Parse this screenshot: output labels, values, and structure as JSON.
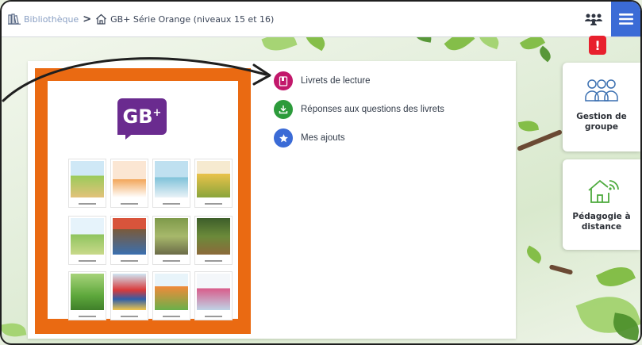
{
  "header": {
    "breadcrumb": {
      "library_label": "Bibliothèque",
      "separator": ">",
      "current_label": "GB+ Série Orange (niveaux 15 et 16)"
    },
    "icons": {
      "library": "books-icon",
      "home": "home-icon",
      "group": "group-icon",
      "menu": "hamburger-menu-icon"
    }
  },
  "alert": {
    "label": "!",
    "color": "#e8202d"
  },
  "collection": {
    "logo": {
      "text": "GB",
      "superscript": "+"
    },
    "cover_color": "#ea6a12",
    "book_count": 12
  },
  "menu_items": [
    {
      "label": "Livrets de lecture",
      "icon": "book-icon",
      "color": "#c2186b"
    },
    {
      "label": "Réponses aux questions des livrets",
      "icon": "download-icon",
      "color": "#2c9b3b"
    },
    {
      "label": "Mes ajouts",
      "icon": "star-icon",
      "color": "#3b6bd6"
    }
  ],
  "side_cards": [
    {
      "label": "Gestion de groupe",
      "icon": "people-group-icon"
    },
    {
      "label": "Pédagogie à distance",
      "icon": "home-wifi-icon"
    }
  ],
  "colors": {
    "accent": "#3b6bd6",
    "brand_purple": "#6a2b8f"
  }
}
